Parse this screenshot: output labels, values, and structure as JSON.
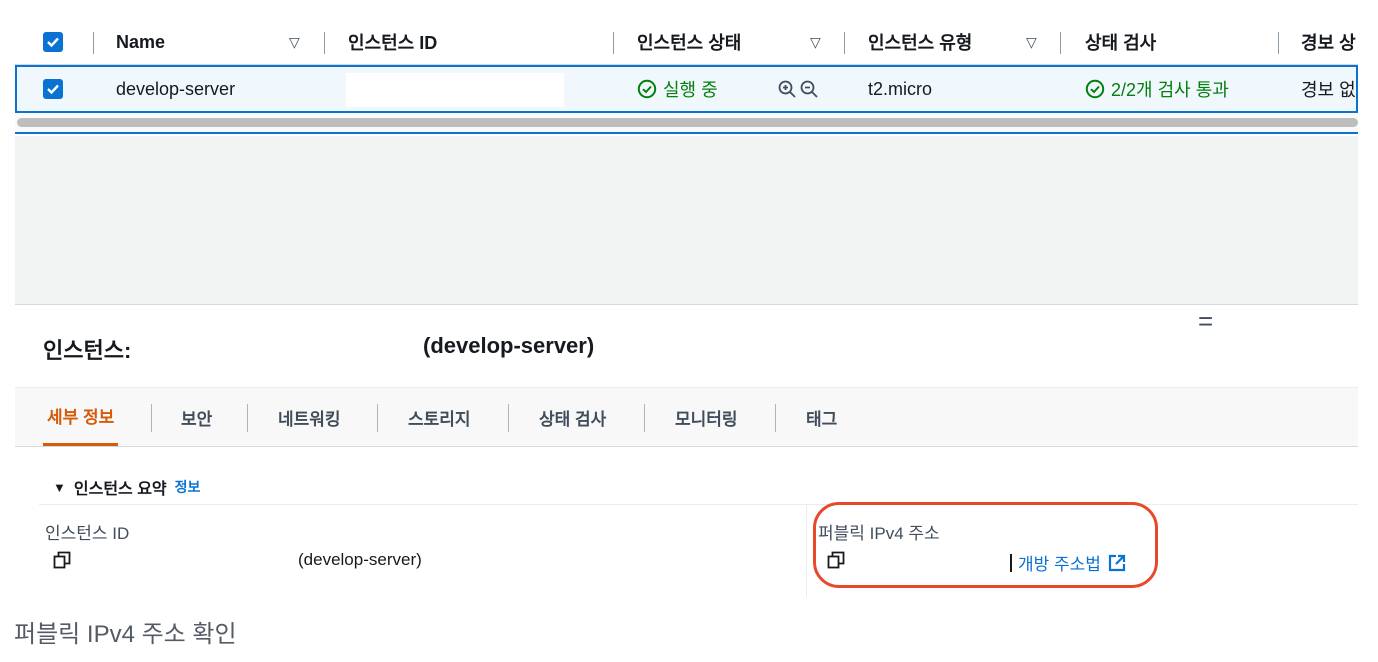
{
  "table": {
    "headers": {
      "name": "Name",
      "instance_id": "인스턴스 ID",
      "instance_state": "인스턴스 상태",
      "instance_type": "인스턴스 유형",
      "status_check": "상태 검사",
      "alarm_status": "경보 상"
    },
    "row": {
      "name": "develop-server",
      "state": "실행 중",
      "type": "t2.micro",
      "status_check": "2/2개 검사 통과",
      "alarm": "경보 없"
    }
  },
  "detail": {
    "title": "인스턴스:",
    "subtitle": "(develop-server)",
    "tabs": [
      {
        "label": "세부 정보"
      },
      {
        "label": "보안"
      },
      {
        "label": "네트워킹"
      },
      {
        "label": "스토리지"
      },
      {
        "label": "상태 검사"
      },
      {
        "label": "모니터링"
      },
      {
        "label": "태그"
      }
    ],
    "section_title": "인스턴스 요약",
    "section_info_link": "정보",
    "instance_id_label": "인스턴스 ID",
    "instance_id_value": "(develop-server)",
    "public_ip_label": "퍼블릭 IPv4 주소",
    "open_address_link": "개방 주소법"
  },
  "caption": "퍼블릭 IPv4 주소 확인",
  "colors": {
    "accent": "#0972d3",
    "active_tab": "#d45b07",
    "success": "#037f0c",
    "highlight": "#e8492a"
  }
}
